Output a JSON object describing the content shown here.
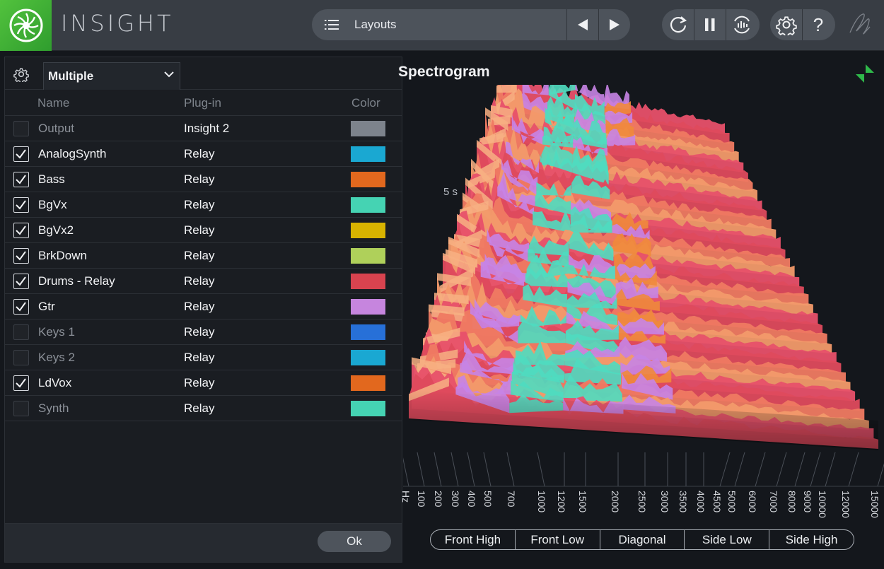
{
  "app": {
    "title": "INSIGHT"
  },
  "toolbar": {
    "layouts_label": "Layouts",
    "icons": [
      "list-icon",
      "prev-arrow-icon",
      "next-arrow-icon",
      "loop-icon",
      "pause-icon",
      "reset-icon",
      "settings-icon",
      "help-icon",
      "signature-icon"
    ],
    "help_glyph": "?"
  },
  "left_panel": {
    "source_select": "Multiple",
    "columns": {
      "name": "Name",
      "plugin": "Plug-in",
      "color": "Color"
    },
    "tracks": [
      {
        "name": "Output",
        "plugin": "Insight 2",
        "checked": false,
        "color": "#7d838c"
      },
      {
        "name": "AnalogSynth",
        "plugin": "Relay",
        "checked": true,
        "color": "#1aa8d2"
      },
      {
        "name": "Bass",
        "plugin": "Relay",
        "checked": true,
        "color": "#e2681e"
      },
      {
        "name": "BgVx",
        "plugin": "Relay",
        "checked": true,
        "color": "#45d3b3"
      },
      {
        "name": "BgVx2",
        "plugin": "Relay",
        "checked": true,
        "color": "#d8b300"
      },
      {
        "name": "BrkDown",
        "plugin": "Relay",
        "checked": true,
        "color": "#afd05a"
      },
      {
        "name": "Drums - Relay",
        "plugin": "Relay",
        "checked": true,
        "color": "#d8434f"
      },
      {
        "name": "Gtr",
        "plugin": "Relay",
        "checked": true,
        "color": "#c685de"
      },
      {
        "name": "Keys 1",
        "plugin": "Relay",
        "checked": false,
        "color": "#2770d8"
      },
      {
        "name": "Keys 2",
        "plugin": "Relay",
        "checked": false,
        "color": "#1aa8d2"
      },
      {
        "name": "LdVox",
        "plugin": "Relay",
        "checked": true,
        "color": "#e2681e"
      },
      {
        "name": "Synth",
        "plugin": "Relay",
        "checked": false,
        "color": "#45d3b3"
      }
    ],
    "ok_label": "Ok"
  },
  "spectrogram": {
    "title": "Spectrogram",
    "time_label": "5 s",
    "freq_labels": [
      "Hz",
      "100",
      "200",
      "300",
      "400",
      "500",
      "700",
      "1000",
      "1200",
      "1500",
      "2000",
      "2500",
      "3000",
      "3500",
      "4000",
      "4500",
      "5000",
      "6000",
      "7000",
      "8000",
      "9000",
      "10000",
      "12000",
      "15000"
    ],
    "view_buttons": [
      "Front High",
      "Front Low",
      "Diagonal",
      "Side Low",
      "Side High"
    ]
  }
}
